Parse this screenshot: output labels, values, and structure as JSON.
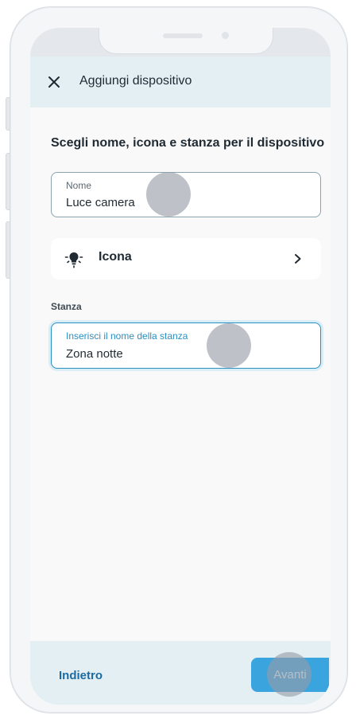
{
  "header": {
    "title": "Aggiungi dispositivo",
    "close_icon": "close-icon"
  },
  "content": {
    "section_title": "Scegli nome, icona e stanza per il dispositivo",
    "name_field": {
      "label": "Nome",
      "value": "Luce camera"
    },
    "icon_row": {
      "icon": "light-bulb-icon",
      "label": "Icona",
      "chevron": "chevron-right-icon"
    },
    "room_section_label": "Stanza",
    "room_field": {
      "label": "Inserisci il nome della stanza",
      "value": "Zona notte"
    }
  },
  "footer": {
    "back_label": "Indietro",
    "next_label": "Avanti"
  },
  "colors": {
    "header_bg": "#e3eff3",
    "accent": "#2b8fc0",
    "link": "#1b6ba0",
    "primary_button": "#3aa4df"
  }
}
